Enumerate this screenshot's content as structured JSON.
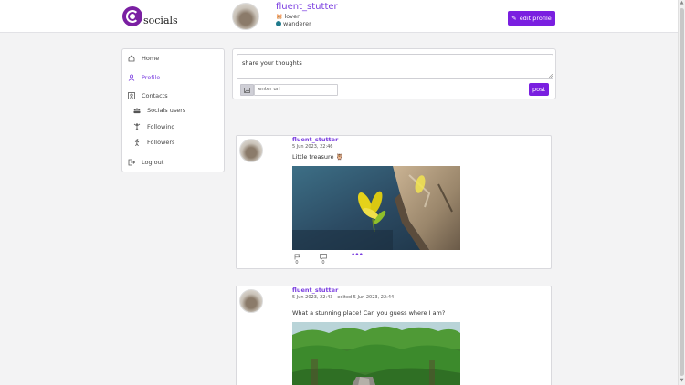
{
  "header": {
    "logo_text": "socials",
    "username": "fluent_stutter",
    "tags": [
      {
        "emoji": "🐹",
        "label": "lover"
      },
      {
        "emoji": "🌍",
        "label": "wanderer"
      }
    ],
    "edit_profile_label": "edit profile"
  },
  "sidebar": {
    "items": [
      {
        "label": "Home",
        "icon": "home-icon"
      },
      {
        "label": "Profile",
        "icon": "user-icon",
        "active": true
      },
      {
        "label": "Contacts",
        "icon": "contacts-icon"
      },
      {
        "label": "Socials users",
        "icon": "users-group-icon"
      },
      {
        "label": "Following",
        "icon": "person-arms-up-icon"
      },
      {
        "label": "Followers",
        "icon": "person-walking-icon"
      },
      {
        "label": "Log out",
        "icon": "logout-icon"
      }
    ]
  },
  "composer": {
    "placeholder": "share your thoughts",
    "url_placeholder": "enter url",
    "post_label": "post"
  },
  "posts": [
    {
      "author": "fluent_stutter",
      "date": "5 Jun 2023, 22:46",
      "text": "Little treasure 🦉",
      "flags": "0",
      "comments": "0",
      "more": "•••"
    },
    {
      "author": "fluent_stutter",
      "date": "5 Jun 2023, 22:43  · edited 5 Jun 2023, 22:44",
      "text": "What a stunning place! Can you guess where I am?"
    }
  ],
  "colors": {
    "accent": "#7a1fe0",
    "link": "#7a3de0"
  }
}
